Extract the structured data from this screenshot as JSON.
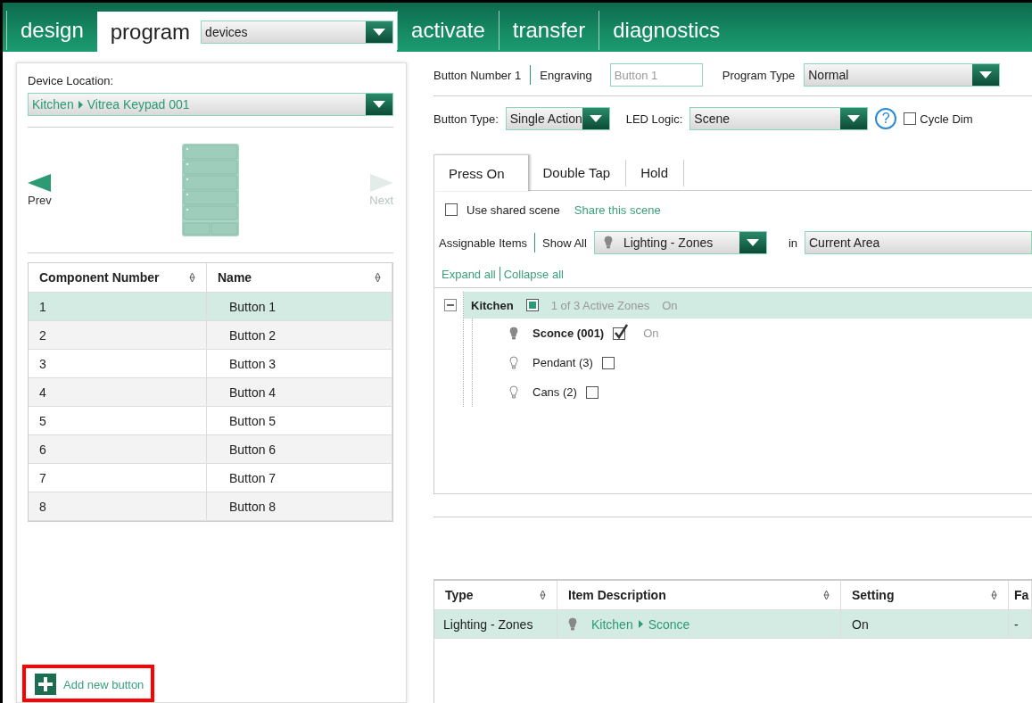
{
  "top_tabs": [
    {
      "label": "design",
      "selected": false
    },
    {
      "label": "program",
      "selected": true,
      "dropdown": "devices"
    },
    {
      "label": "activate",
      "selected": false
    },
    {
      "label": "transfer",
      "selected": false
    },
    {
      "label": "diagnostics",
      "selected": false
    }
  ],
  "left_panel": {
    "device_location_label": "Device Location:",
    "device_location": [
      "Kitchen",
      "Vitrea Keypad 001"
    ],
    "prev": {
      "label": "Prev",
      "disabled": false
    },
    "next": {
      "label": "Next",
      "disabled": true
    },
    "table": {
      "columns": [
        "Component Number",
        "Name"
      ],
      "rows": [
        {
          "number": "1",
          "name": "Button 1",
          "selected": true
        },
        {
          "number": "2",
          "name": "Button 2",
          "selected": false
        },
        {
          "number": "3",
          "name": "Button 3",
          "selected": false
        },
        {
          "number": "4",
          "name": "Button 4",
          "selected": false
        },
        {
          "number": "5",
          "name": "Button 5",
          "selected": false
        },
        {
          "number": "6",
          "name": "Button 6",
          "selected": false
        },
        {
          "number": "7",
          "name": "Button 7",
          "selected": false
        },
        {
          "number": "8",
          "name": "Button 8",
          "selected": false
        }
      ]
    },
    "add_button": {
      "label": "Add new button",
      "highlighted": true
    }
  },
  "right_panel": {
    "button_number": "Button Number 1",
    "engraving_label": "Engraving",
    "engraving_value": "Button 1",
    "program_type_label": "Program Type",
    "program_type": "Normal",
    "button_type_label": "Button Type:",
    "button_type": "Single Action",
    "led_logic_label": "LED Logic:",
    "led_logic": "Scene",
    "help": "?",
    "cycle_dim": {
      "label": "Cycle Dim",
      "checked": false
    },
    "tabs": [
      {
        "label": "Press On",
        "selected": true
      },
      {
        "label": "Double Tap",
        "selected": false
      },
      {
        "label": "Hold",
        "selected": false
      }
    ],
    "use_shared_scene": {
      "label": "Use shared scene",
      "checked": false
    },
    "share_link": "Share this scene",
    "assignable_label": "Assignable Items",
    "show_all": "Show All",
    "category": "Lighting - Zones",
    "in_label": "in",
    "area": "Current Area",
    "expand_all": "Expand all",
    "collapse_all": "Collapse all",
    "tree": [
      {
        "name": "Kitchen",
        "expanded": true,
        "selected": true,
        "partial": true,
        "summary": "1 of 3 Active Zones",
        "status": "On",
        "children": [
          {
            "name": "Sconce (001)",
            "checked": true,
            "status": "On"
          },
          {
            "name": "Pendant (3)",
            "checked": false
          },
          {
            "name": "Cans (2)",
            "checked": false
          }
        ]
      }
    ],
    "assigned_table": {
      "columns": [
        "Type",
        "Item Description",
        "Setting",
        "Fa"
      ],
      "rows": [
        {
          "type": "Lighting - Zones",
          "description": [
            "Kitchen",
            "Sconce"
          ],
          "setting": "On",
          "column_4": "-",
          "selected": true
        }
      ]
    }
  }
}
